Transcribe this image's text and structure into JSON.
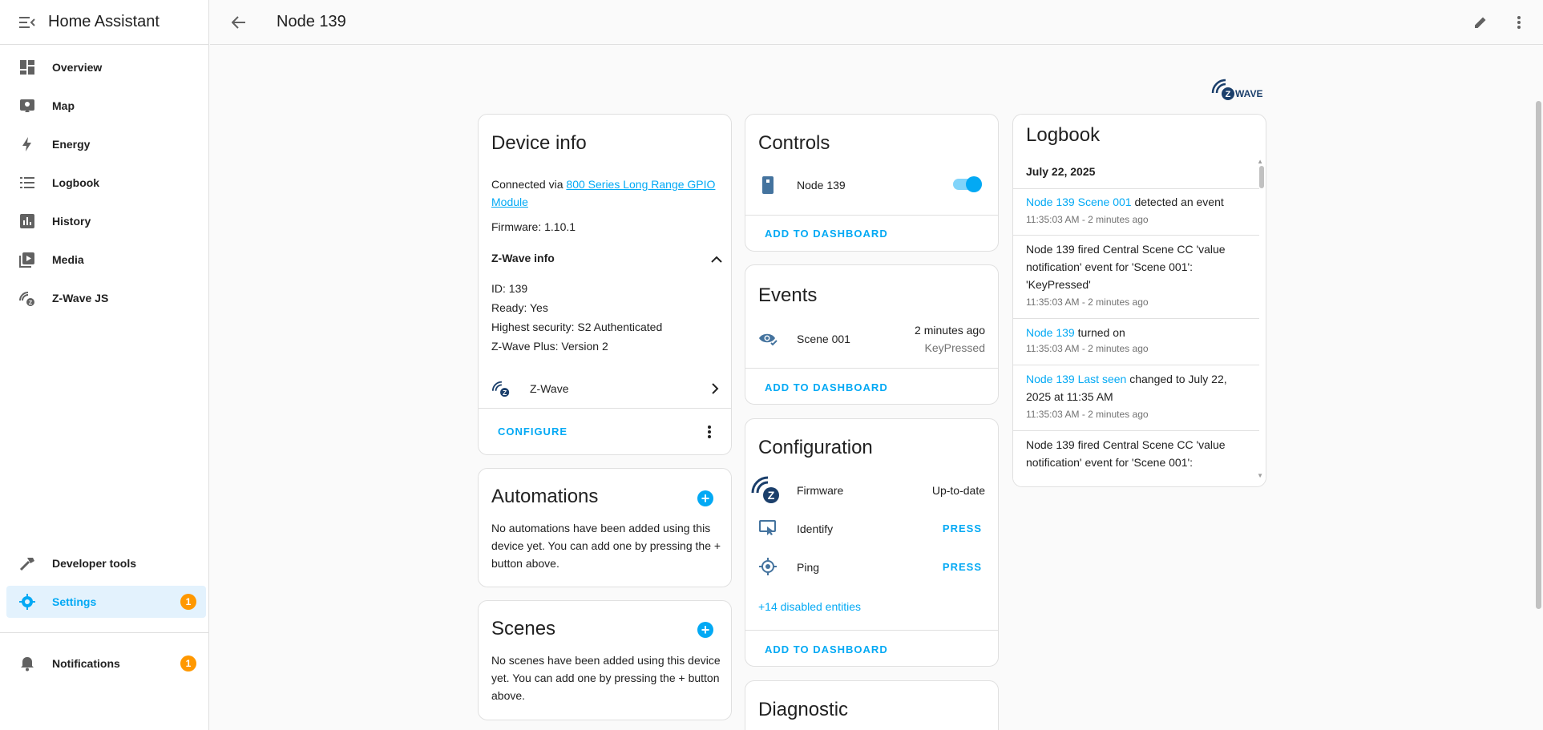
{
  "app": {
    "title": "Home Assistant"
  },
  "sidebar": {
    "items": [
      {
        "label": "Overview",
        "icon": "dashboard-icon"
      },
      {
        "label": "Map",
        "icon": "map-icon"
      },
      {
        "label": "Energy",
        "icon": "lightning-icon"
      },
      {
        "label": "Logbook",
        "icon": "list-icon"
      },
      {
        "label": "History",
        "icon": "chart-icon"
      },
      {
        "label": "Media",
        "icon": "media-icon"
      },
      {
        "label": "Z-Wave JS",
        "icon": "zwave-icon"
      }
    ],
    "developer_tools": "Developer tools",
    "settings": {
      "label": "Settings",
      "badge": "1"
    },
    "notifications": {
      "label": "Notifications",
      "badge": "1"
    }
  },
  "header": {
    "title": "Node 139"
  },
  "device_info": {
    "title": "Device info",
    "connected_prefix": "Connected via ",
    "connected_link_line1": "800 Series Long Range GPIO",
    "connected_link_line2": "Module",
    "firmware": "Firmware: 1.10.1",
    "zwave_info_label": "Z-Wave info",
    "id": "ID: 139",
    "ready": "Ready: Yes",
    "security": "Highest security: S2 Authenticated",
    "zwave_plus": "Z-Wave Plus: Version 2",
    "integration": "Z-Wave",
    "configure": "CONFIGURE"
  },
  "automations": {
    "title": "Automations",
    "text_line1": "No automations have been added using this",
    "text_line2": "device yet. You can add one by pressing the +",
    "text_line3": "button above."
  },
  "scenes": {
    "title": "Scenes",
    "text_line1": "No scenes have been added using this device",
    "text_line2": "yet. You can add one by pressing the + button",
    "text_line3": "above."
  },
  "controls": {
    "title": "Controls",
    "entity": "Node 139",
    "toggle_on": true,
    "add": "ADD TO DASHBOARD"
  },
  "events": {
    "title": "Events",
    "entity": "Scene 001",
    "time": "2 minutes ago",
    "state": "KeyPressed",
    "add": "ADD TO DASHBOARD"
  },
  "configuration": {
    "title": "Configuration",
    "firmware_label": "Firmware",
    "firmware_state": "Up-to-date",
    "identify_label": "Identify",
    "identify_action": "PRESS",
    "ping_label": "Ping",
    "ping_action": "PRESS",
    "disabled": "+14 disabled entities",
    "add": "ADD TO DASHBOARD"
  },
  "diagnostic": {
    "title": "Diagnostic"
  },
  "logbook": {
    "title": "Logbook",
    "date": "July 22, 2025",
    "entries": [
      {
        "link": "Node 139 Scene 001",
        "text": " detected an event",
        "time": "11:35:03 AM - 2 minutes ago"
      },
      {
        "line1": "Node 139 fired Central Scene CC 'value",
        "line2": "notification' event for 'Scene 001':",
        "line3": "'KeyPressed'",
        "time": "11:35:03 AM - 2 minutes ago"
      },
      {
        "link": "Node 139",
        "text": " turned on",
        "time": "11:35:03 AM - 2 minutes ago"
      },
      {
        "link": "Node 139 Last seen",
        "text": " changed to July 22,",
        "line2": "2025 at 11:35 AM",
        "time": "11:35:03 AM - 2 minutes ago"
      },
      {
        "line1": "Node 139 fired Central Scene CC 'value",
        "line2": "notification' event for 'Scene 001':"
      }
    ]
  },
  "colors": {
    "accent": "#03a9f4",
    "badge": "#ff9800",
    "zwave_blue": "#1b3f6b"
  }
}
